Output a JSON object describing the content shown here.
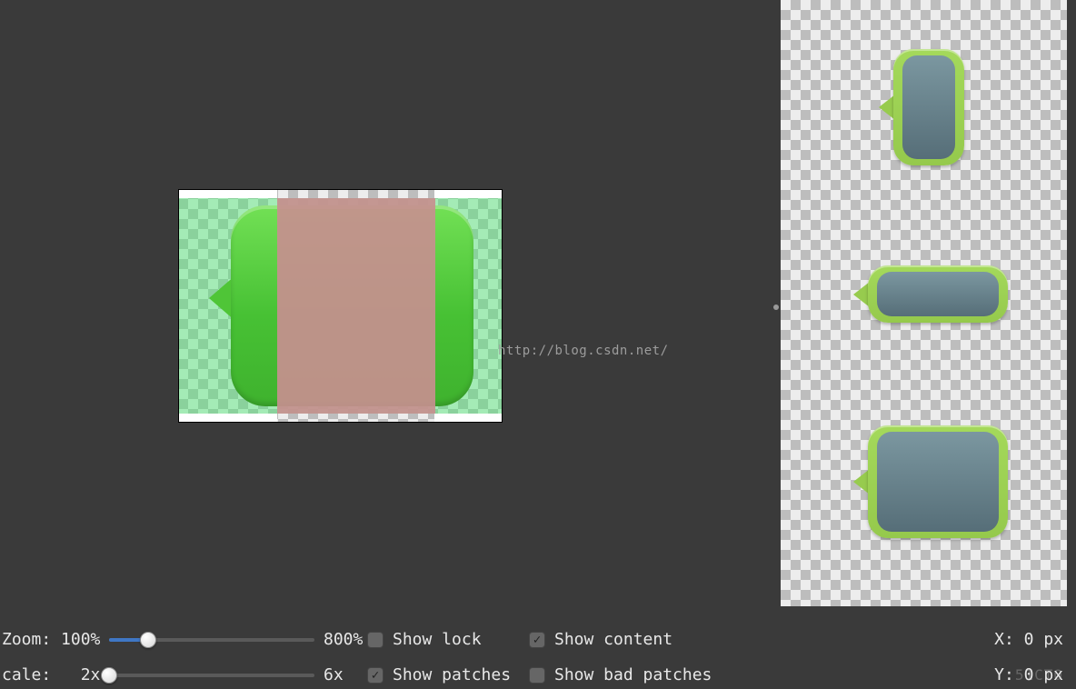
{
  "watermark": "http://blog.csdn.net/",
  "footer": {
    "zoom": {
      "label": "Zoom: ",
      "min_label": "100%",
      "max_label": "800%",
      "pos_pct": 19
    },
    "scale": {
      "label": "cale:",
      "value_label": "   2x",
      "max_label": "6x",
      "pos_pct": 0
    },
    "cb_show_lock": "Show lock",
    "cb_show_patches": "Show patches",
    "cb_show_content": "Show content",
    "cb_show_bad_patches": "Show bad patches",
    "x_label": "X: 0 px",
    "y_label": "Y: 0 px",
    "y_label_watermark": "51CTO"
  },
  "checkboxes": {
    "show_lock": false,
    "show_patches": true,
    "show_content": true,
    "show_bad_patches": false
  }
}
